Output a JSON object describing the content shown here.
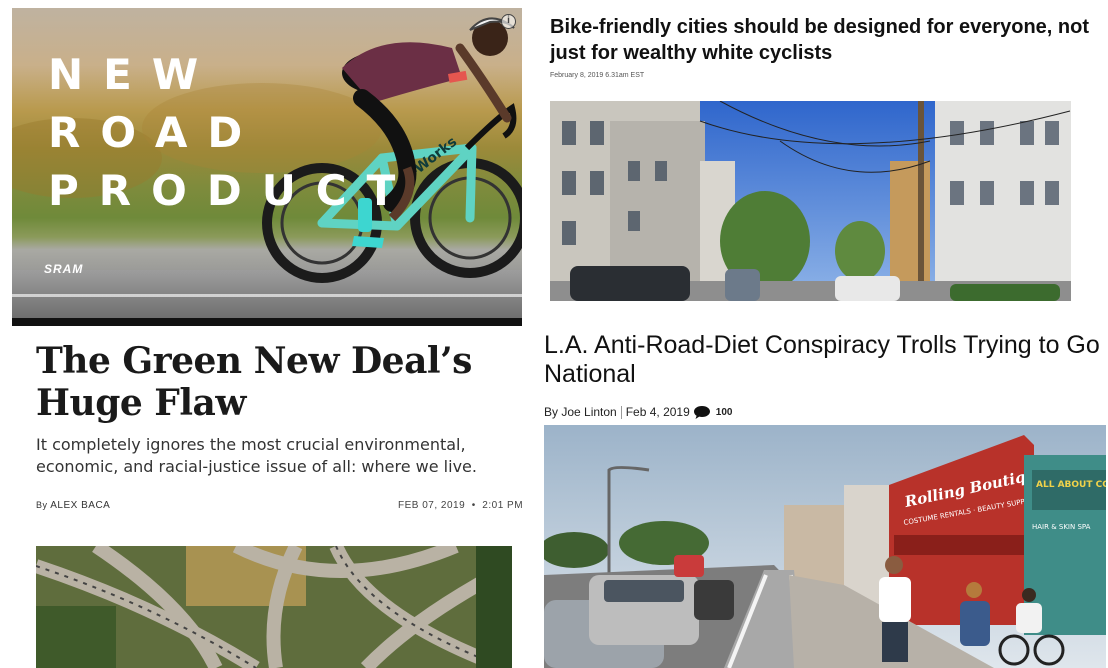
{
  "left": {
    "ad": {
      "headline_lines": [
        "NEW",
        "ROAD",
        "PRODUCT"
      ],
      "brand": "SRAM",
      "bike_text": "S-Works",
      "info_icon": "info-icon"
    },
    "article": {
      "title": "The Green New Deal’s Huge Flaw",
      "dek": "It completely ignores the most crucial environmental, economic, and racial-justice issue of all: where we live.",
      "byline_prefix": "By",
      "author": "ALEX BACA",
      "date": "FEB 07, 2019",
      "separator": "•",
      "time": "2:01 PM"
    }
  },
  "right": {
    "article1": {
      "title": "Bike-friendly cities should be designed for everyone, not just for wealthy white cyclists",
      "date": "February 8, 2019 6.31am EST"
    },
    "article2": {
      "title": "L.A. Anti-Road-Diet Conspiracy Trolls Trying to Go National",
      "byline": "By Joe Linton",
      "date": "Feb 4, 2019",
      "comment_icon": "comment-icon",
      "comment_count": "100",
      "storefront_signs": [
        "Rolling Boutiques",
        "COSTUME RENTALS · BEAUTY SUPPLIES",
        "ALL ABOUT COLOR",
        "HAIR & SKIN SPA"
      ]
    }
  },
  "colors": {
    "ad_road_line": "#e5e5e5",
    "bike_frame": "#5fd3c3",
    "jersey": "#6b2f45",
    "sky_blue": "#3f76d4",
    "storefront_red": "#b8322a"
  }
}
